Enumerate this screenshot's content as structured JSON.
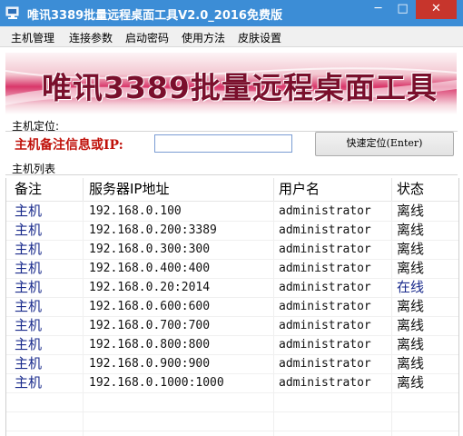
{
  "window": {
    "title": "唯讯3389批量远程桌面工具V2.0_2016免费版",
    "minimize_glyph": "─",
    "maximize_glyph": "□",
    "close_glyph": "✕"
  },
  "menu": [
    {
      "label": "主机管理"
    },
    {
      "label": "连接参数"
    },
    {
      "label": "启动密码"
    },
    {
      "label": "使用方法"
    },
    {
      "label": "皮肤设置"
    }
  ],
  "banner": {
    "text": "唯讯3389批量远程桌面工具"
  },
  "locate": {
    "group_label": "主机定位:",
    "field_label": "主机备注信息或IP:",
    "input_value": "",
    "button_label": "快速定位(Enter)"
  },
  "host_list": {
    "group_label": "主机列表",
    "columns": [
      "备注",
      "服务器IP地址",
      "用户名",
      "状态"
    ],
    "rows": [
      {
        "note": "主机",
        "ip": "192.168.0.100",
        "user": "administrator",
        "status": "离线"
      },
      {
        "note": "主机",
        "ip": "192.168.0.200:3389",
        "user": "administrator",
        "status": "离线"
      },
      {
        "note": "主机",
        "ip": "192.168.0.300:300",
        "user": "administrator",
        "status": "离线"
      },
      {
        "note": "主机",
        "ip": "192.168.0.400:400",
        "user": "administrator",
        "status": "离线"
      },
      {
        "note": "主机",
        "ip": "192.168.0.20:2014",
        "user": "administrator",
        "status": "在线"
      },
      {
        "note": "主机",
        "ip": "192.168.0.600:600",
        "user": "administrator",
        "status": "离线"
      },
      {
        "note": "主机",
        "ip": "192.168.0.700:700",
        "user": "administrator",
        "status": "离线"
      },
      {
        "note": "主机",
        "ip": "192.168.0.800:800",
        "user": "administrator",
        "status": "离线"
      },
      {
        "note": "主机",
        "ip": "192.168.0.900:900",
        "user": "administrator",
        "status": "离线"
      },
      {
        "note": "主机",
        "ip": "192.168.0.1000:1000",
        "user": "administrator",
        "status": "离线"
      }
    ]
  },
  "icons": {
    "app": "monitor-icon"
  },
  "colors": {
    "titlebar": "#3c8dd6",
    "close_button": "#c7352c",
    "label_red": "#c0120b",
    "note_blue": "#1a2b8c",
    "banner_accent": "#d9376a"
  }
}
